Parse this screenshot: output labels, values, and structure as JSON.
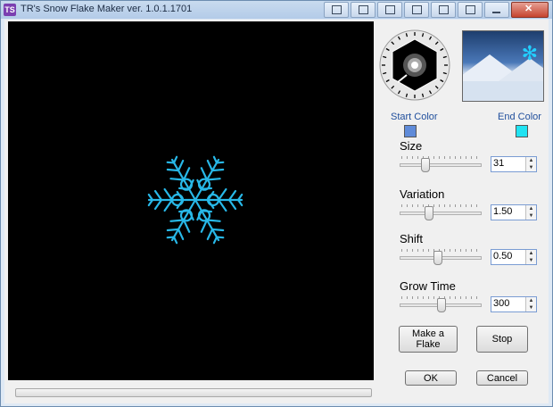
{
  "window": {
    "title": "TR's Snow Flake Maker ver. 1.0.1.1701",
    "icon_text": "TS"
  },
  "titlebar_buttons": [
    "monitor-icon",
    "pin-icon",
    "window-icon",
    "grid-icon",
    "layout-icon",
    "restore-icon",
    "minimize-icon",
    "tile-icon"
  ],
  "colors": {
    "start": "#5f8bd9",
    "end": "#21e3f2",
    "canvas": "#000000",
    "flake": "#28b8e8"
  },
  "labels": {
    "start_color": "Start Color",
    "end_color": "End Color"
  },
  "controls": [
    {
      "id": "size",
      "label": "Size",
      "value": "31",
      "level": 0.28
    },
    {
      "id": "variation",
      "label": "Variation",
      "value": "1.50",
      "level": 0.33
    },
    {
      "id": "shift",
      "label": "Shift",
      "value": "0.50",
      "level": 0.45
    },
    {
      "id": "grow",
      "label": "Grow Time",
      "value": "300",
      "level": 0.5
    }
  ],
  "buttons": {
    "make": "Make a Flake",
    "stop": "Stop",
    "ok": "OK",
    "cancel": "Cancel"
  },
  "progress": 0
}
